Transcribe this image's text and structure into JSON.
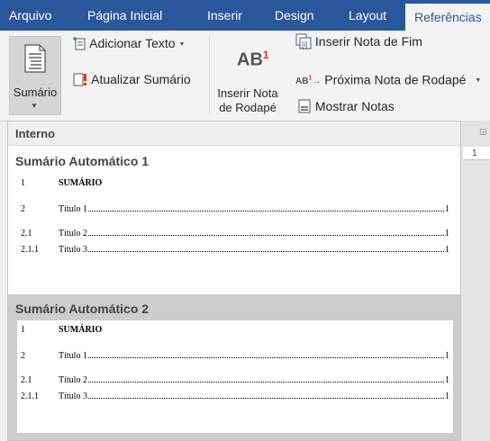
{
  "tabs": [
    {
      "label": "Arquivo"
    },
    {
      "label": "Página Inicial"
    },
    {
      "label": "Inserir"
    },
    {
      "label": "Design"
    },
    {
      "label": "Layout"
    },
    {
      "label": "Referências"
    }
  ],
  "ribbon": {
    "sumario_label": "Sumário",
    "adicionar_texto": "Adicionar Texto",
    "atualizar_sumario": "Atualizar Sumário",
    "inserir_nota_line1": "Inserir Nota",
    "inserir_nota_line2": "de Rodapé",
    "ab_text": "AB",
    "ab_sup": "1",
    "inserir_nota_fim": "Inserir Nota de Fim",
    "proxima_nota": "Próxima Nota de Rodapé",
    "mostrar_notas": "Mostrar Notas"
  },
  "document": {
    "ruler_number": "1"
  },
  "gallery": {
    "section_header": "Interno",
    "items": [
      {
        "title": "Sumário Automático 1",
        "entries": [
          {
            "num": "1",
            "text": "SUMÁRIO",
            "page": ""
          },
          {
            "num": "2",
            "text": "Título 1",
            "page": "1"
          },
          {
            "num": "2.1",
            "text": "Título 2",
            "page": "1"
          },
          {
            "num": "2.1.1",
            "text": "Título 3",
            "page": "1"
          }
        ]
      },
      {
        "title": "Sumário Automático 2",
        "entries": [
          {
            "num": "1",
            "text": "SUMÁRIO",
            "page": ""
          },
          {
            "num": "2",
            "text": "Título 1",
            "page": "1"
          },
          {
            "num": "2.1",
            "text": "Título 2",
            "page": "1"
          },
          {
            "num": "2.1.1",
            "text": "Título 3",
            "page": "1"
          }
        ]
      }
    ]
  }
}
